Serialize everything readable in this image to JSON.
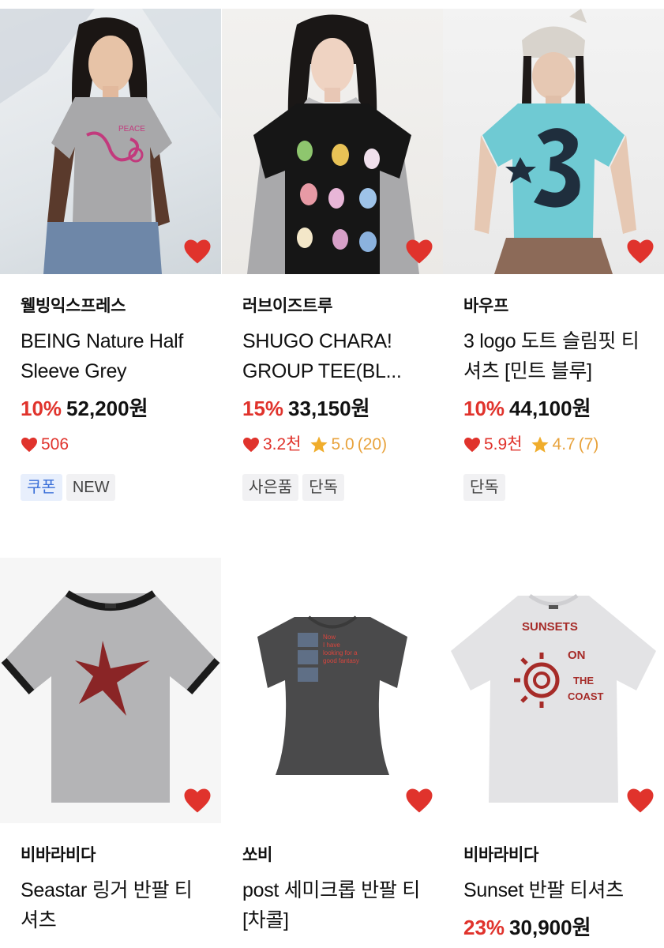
{
  "colors": {
    "accent_red": "#e0332c",
    "rating_orange": "#e8a33d",
    "coupon_blue": "#3a6fd8"
  },
  "products": [
    {
      "brand": "웰빙익스프레스",
      "name": "BEING Nature Half Sleeve Grey",
      "discount": "10%",
      "price": "52,200원",
      "likes": "506",
      "rating": "",
      "reviews": "",
      "tags": [
        "쿠폰",
        "NEW"
      ],
      "image_icon": "gray-tshirt-model-photo"
    },
    {
      "brand": "러브이즈트루",
      "name": "SHUGO CHARA! GROUP TEE(BL...",
      "discount": "15%",
      "price": "33,150원",
      "likes": "3.2천",
      "rating": "5.0",
      "reviews": "(20)",
      "tags": [
        "사은품",
        "단독"
      ],
      "image_icon": "black-tshirt-model-photo"
    },
    {
      "brand": "바우프",
      "name": "3 logo 도트 슬림핏 티셔츠 [민트 블루]",
      "discount": "10%",
      "price": "44,100원",
      "likes": "5.9천",
      "rating": "4.7",
      "reviews": "(7)",
      "tags": [
        "단독"
      ],
      "image_icon": "mint-tshirt-model-photo"
    },
    {
      "brand": "비바라비다",
      "name": "Seastar 링거 반팔 티셔츠",
      "discount": "",
      "price": "",
      "image_icon": "ringer-tshirt-photo"
    },
    {
      "brand": "쏘비",
      "name": "post 세미크롭 반팔 티 [차콜]",
      "discount": "",
      "price": "",
      "image_icon": "charcoal-tshirt-photo"
    },
    {
      "brand": "비바라비다",
      "name": "Sunset 반팔 티셔츠",
      "discount": "23%",
      "price": "30,900원",
      "image_icon": "sunset-tshirt-photo"
    }
  ]
}
